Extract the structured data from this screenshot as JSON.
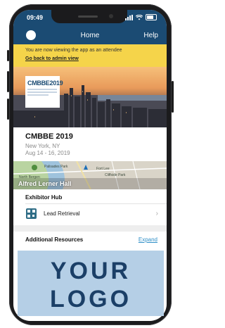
{
  "status_bar": {
    "time": "09:49"
  },
  "nav": {
    "title": "Home",
    "help": "Help"
  },
  "banner": {
    "text": "You are now viewing the app as an attendee",
    "link": "Go back to admin view",
    "color": "#f5d44a"
  },
  "event": {
    "logo_text": "CMBBE2019",
    "name": "CMBBE 2019",
    "location": "New York, NY",
    "dates": "Aug 14 - 16, 2019"
  },
  "map": {
    "venue": "Alfred Lerner Hall",
    "labels": [
      "Palisades Park",
      "Fort Lee",
      "North Bergen",
      "Cliffside Park"
    ]
  },
  "exhibitor_hub": {
    "heading": "Exhibitor Hub",
    "items": [
      {
        "label": "Lead Retrieval",
        "icon": "qr-code-icon"
      }
    ]
  },
  "resources": {
    "heading": "Additional Resources",
    "expand": "Expand"
  },
  "overlay_logo": {
    "line1": "YOUR",
    "line2": "LOGO"
  },
  "colors": {
    "header": "#1b4b73",
    "accent_link": "#2f8fc7",
    "logo_bg": "#b5cfe6"
  }
}
